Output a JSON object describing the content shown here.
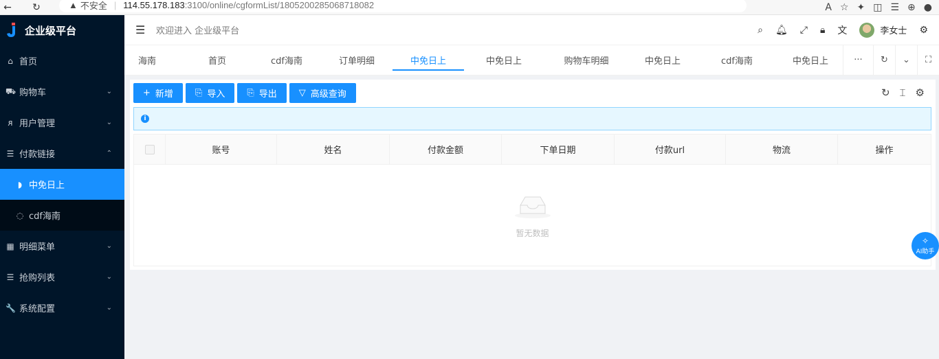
{
  "browser": {
    "insecure_label": "不安全",
    "url_host": "114.55.178.183",
    "url_path": ":3100/online/cgformList/1805200285068718082"
  },
  "sidebar": {
    "brand": "企业级平台",
    "items": [
      {
        "label": "首页",
        "icon": "home-icon"
      },
      {
        "label": "购物车",
        "icon": "cart-icon"
      },
      {
        "label": "用户管理",
        "icon": "user-icon"
      },
      {
        "label": "付款链接",
        "icon": "list-icon"
      },
      {
        "label": "中免日上",
        "icon": "tag-icon"
      },
      {
        "label": "cdf海南",
        "icon": "tag-icon"
      },
      {
        "label": "明细菜单",
        "icon": "grid-icon"
      },
      {
        "label": "抢购列表",
        "icon": "list-icon"
      },
      {
        "label": "系统配置",
        "icon": "wrench-icon"
      }
    ]
  },
  "header": {
    "welcome": "欢迎进入 企业级平台",
    "username": "李女士"
  },
  "tabs": {
    "items": [
      "海南",
      "首页",
      "cdf海南",
      "订单明细",
      "中免日上",
      "中免日上",
      "购物车明细",
      "中免日上",
      "cdf海南",
      "中免日上"
    ],
    "more": "···"
  },
  "toolbar": {
    "add": "新增",
    "import": "导入",
    "export": "导出",
    "advanced_query": "高级查询"
  },
  "table": {
    "columns": [
      "账号",
      "姓名",
      "付款金额",
      "下单日期",
      "付款url",
      "物流",
      "操作"
    ],
    "empty_text": "暂无数据"
  },
  "ai": {
    "label": "AI助手"
  },
  "colors": {
    "primary": "#1890ff",
    "sidebar_bg": "#001529",
    "alert_bg": "#e6f7ff"
  }
}
